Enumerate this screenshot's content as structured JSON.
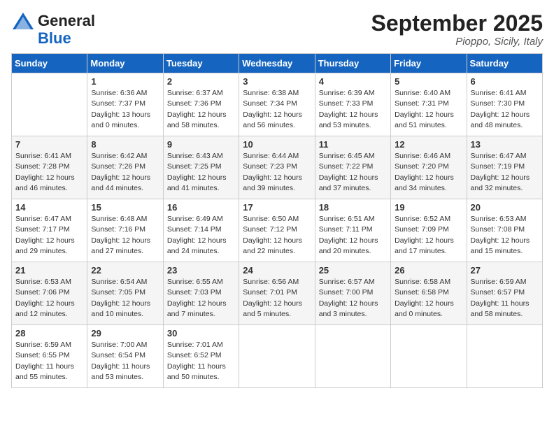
{
  "header": {
    "logo_general": "General",
    "logo_blue": "Blue",
    "month_title": "September 2025",
    "location": "Pioppo, Sicily, Italy"
  },
  "weekdays": [
    "Sunday",
    "Monday",
    "Tuesday",
    "Wednesday",
    "Thursday",
    "Friday",
    "Saturday"
  ],
  "weeks": [
    [
      {
        "day": "",
        "info": ""
      },
      {
        "day": "1",
        "info": "Sunrise: 6:36 AM\nSunset: 7:37 PM\nDaylight: 13 hours\nand 0 minutes."
      },
      {
        "day": "2",
        "info": "Sunrise: 6:37 AM\nSunset: 7:36 PM\nDaylight: 12 hours\nand 58 minutes."
      },
      {
        "day": "3",
        "info": "Sunrise: 6:38 AM\nSunset: 7:34 PM\nDaylight: 12 hours\nand 56 minutes."
      },
      {
        "day": "4",
        "info": "Sunrise: 6:39 AM\nSunset: 7:33 PM\nDaylight: 12 hours\nand 53 minutes."
      },
      {
        "day": "5",
        "info": "Sunrise: 6:40 AM\nSunset: 7:31 PM\nDaylight: 12 hours\nand 51 minutes."
      },
      {
        "day": "6",
        "info": "Sunrise: 6:41 AM\nSunset: 7:30 PM\nDaylight: 12 hours\nand 48 minutes."
      }
    ],
    [
      {
        "day": "7",
        "info": "Sunrise: 6:41 AM\nSunset: 7:28 PM\nDaylight: 12 hours\nand 46 minutes."
      },
      {
        "day": "8",
        "info": "Sunrise: 6:42 AM\nSunset: 7:26 PM\nDaylight: 12 hours\nand 44 minutes."
      },
      {
        "day": "9",
        "info": "Sunrise: 6:43 AM\nSunset: 7:25 PM\nDaylight: 12 hours\nand 41 minutes."
      },
      {
        "day": "10",
        "info": "Sunrise: 6:44 AM\nSunset: 7:23 PM\nDaylight: 12 hours\nand 39 minutes."
      },
      {
        "day": "11",
        "info": "Sunrise: 6:45 AM\nSunset: 7:22 PM\nDaylight: 12 hours\nand 37 minutes."
      },
      {
        "day": "12",
        "info": "Sunrise: 6:46 AM\nSunset: 7:20 PM\nDaylight: 12 hours\nand 34 minutes."
      },
      {
        "day": "13",
        "info": "Sunrise: 6:47 AM\nSunset: 7:19 PM\nDaylight: 12 hours\nand 32 minutes."
      }
    ],
    [
      {
        "day": "14",
        "info": "Sunrise: 6:47 AM\nSunset: 7:17 PM\nDaylight: 12 hours\nand 29 minutes."
      },
      {
        "day": "15",
        "info": "Sunrise: 6:48 AM\nSunset: 7:16 PM\nDaylight: 12 hours\nand 27 minutes."
      },
      {
        "day": "16",
        "info": "Sunrise: 6:49 AM\nSunset: 7:14 PM\nDaylight: 12 hours\nand 24 minutes."
      },
      {
        "day": "17",
        "info": "Sunrise: 6:50 AM\nSunset: 7:12 PM\nDaylight: 12 hours\nand 22 minutes."
      },
      {
        "day": "18",
        "info": "Sunrise: 6:51 AM\nSunset: 7:11 PM\nDaylight: 12 hours\nand 20 minutes."
      },
      {
        "day": "19",
        "info": "Sunrise: 6:52 AM\nSunset: 7:09 PM\nDaylight: 12 hours\nand 17 minutes."
      },
      {
        "day": "20",
        "info": "Sunrise: 6:53 AM\nSunset: 7:08 PM\nDaylight: 12 hours\nand 15 minutes."
      }
    ],
    [
      {
        "day": "21",
        "info": "Sunrise: 6:53 AM\nSunset: 7:06 PM\nDaylight: 12 hours\nand 12 minutes."
      },
      {
        "day": "22",
        "info": "Sunrise: 6:54 AM\nSunset: 7:05 PM\nDaylight: 12 hours\nand 10 minutes."
      },
      {
        "day": "23",
        "info": "Sunrise: 6:55 AM\nSunset: 7:03 PM\nDaylight: 12 hours\nand 7 minutes."
      },
      {
        "day": "24",
        "info": "Sunrise: 6:56 AM\nSunset: 7:01 PM\nDaylight: 12 hours\nand 5 minutes."
      },
      {
        "day": "25",
        "info": "Sunrise: 6:57 AM\nSunset: 7:00 PM\nDaylight: 12 hours\nand 3 minutes."
      },
      {
        "day": "26",
        "info": "Sunrise: 6:58 AM\nSunset: 6:58 PM\nDaylight: 12 hours\nand 0 minutes."
      },
      {
        "day": "27",
        "info": "Sunrise: 6:59 AM\nSunset: 6:57 PM\nDaylight: 11 hours\nand 58 minutes."
      }
    ],
    [
      {
        "day": "28",
        "info": "Sunrise: 6:59 AM\nSunset: 6:55 PM\nDaylight: 11 hours\nand 55 minutes."
      },
      {
        "day": "29",
        "info": "Sunrise: 7:00 AM\nSunset: 6:54 PM\nDaylight: 11 hours\nand 53 minutes."
      },
      {
        "day": "30",
        "info": "Sunrise: 7:01 AM\nSunset: 6:52 PM\nDaylight: 11 hours\nand 50 minutes."
      },
      {
        "day": "",
        "info": ""
      },
      {
        "day": "",
        "info": ""
      },
      {
        "day": "",
        "info": ""
      },
      {
        "day": "",
        "info": ""
      }
    ]
  ]
}
